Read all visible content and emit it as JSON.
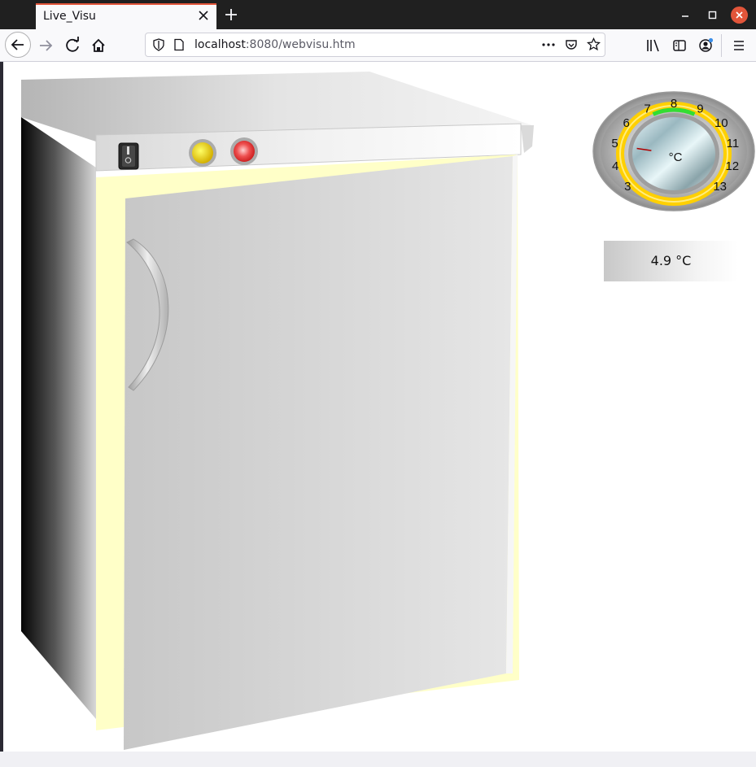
{
  "browser": {
    "tab_title": "Live_Visu",
    "url_host": "localhost",
    "url_rest": ":8080/webvisu.htm"
  },
  "thermostat": {
    "scale_labels": [
      "3",
      "4",
      "5",
      "6",
      "7",
      "8",
      "9",
      "10",
      "11",
      "12",
      "13"
    ],
    "unit": "°C",
    "setpoint": 4.9,
    "scale_min": 3,
    "scale_max": 13,
    "green_band": [
      7,
      9
    ]
  },
  "display": {
    "temperature_text": "4.9 °C"
  },
  "colors": {
    "door_frame": "#ffffc8",
    "lamp_yellow": "#f2d800",
    "lamp_red": "#e23030",
    "gauge_ring": "#ffd000",
    "gauge_green": "#33dd33",
    "needle": "#b00000",
    "tab_accent": "#e2553a"
  }
}
